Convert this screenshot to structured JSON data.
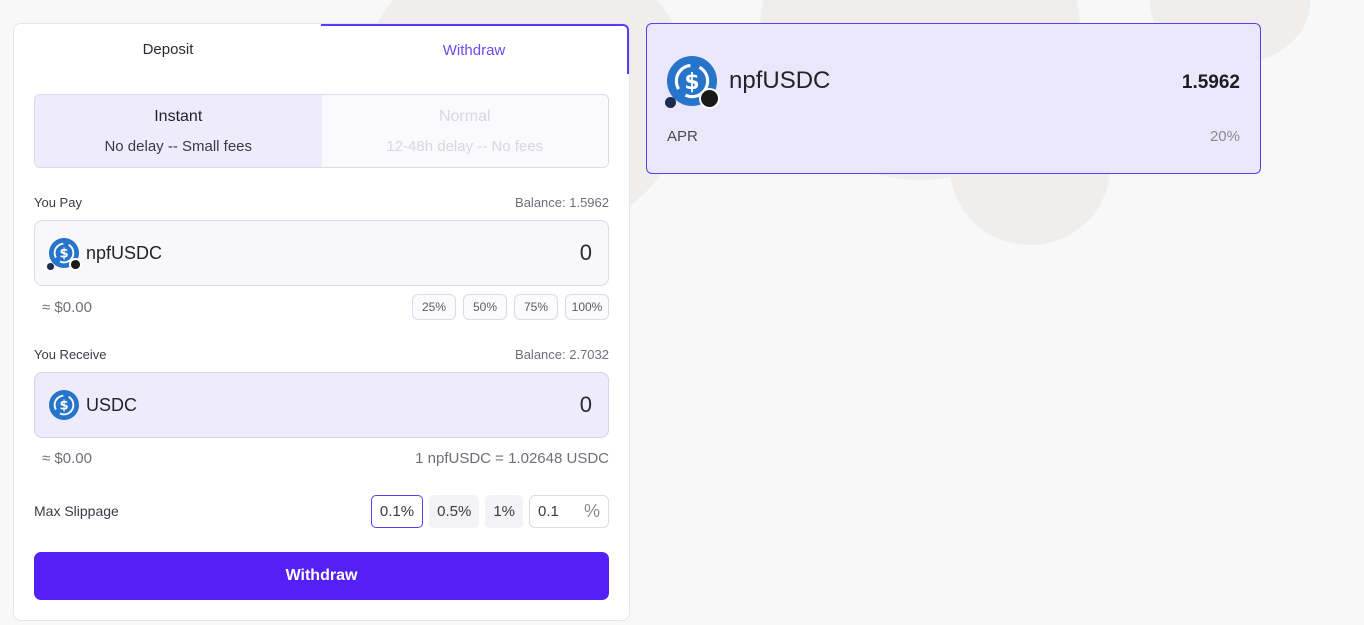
{
  "tabs": {
    "deposit": "Deposit",
    "withdraw": "Withdraw"
  },
  "mode": {
    "instant": {
      "title": "Instant",
      "subtitle": "No delay -- Small fees"
    },
    "normal": {
      "title": "Normal",
      "subtitle": "12-48h delay -- No fees"
    }
  },
  "pay": {
    "label": "You Pay",
    "balance": "Balance: 1.5962",
    "token": "npfUSDC",
    "amount": "0",
    "usd": "≈ $0.00",
    "percents": [
      "25%",
      "50%",
      "75%",
      "100%"
    ]
  },
  "receive": {
    "label": "You Receive",
    "balance": "Balance: 2.7032",
    "token": "USDC",
    "amount": "0",
    "usd": "≈ $0.00",
    "rate": "1 npfUSDC = 1.02648 USDC"
  },
  "slippage": {
    "label": "Max Slippage",
    "options": [
      "0.1%",
      "0.5%",
      "1%"
    ],
    "selected": "0.1%",
    "custom_value": "0.1",
    "unit": "%"
  },
  "action": {
    "label": "Withdraw"
  },
  "card": {
    "token": "npfUSDC",
    "value": "1.5962",
    "apr_label": "APR",
    "apr_value": "20%"
  },
  "icons": {
    "usdc": "usdc-coin-icon",
    "npfusdc": "npfusdc-coin-icon"
  },
  "colors": {
    "accent": "#5520f5",
    "tab_active": "#6b4bf0",
    "usdc_blue": "#2775ca"
  }
}
